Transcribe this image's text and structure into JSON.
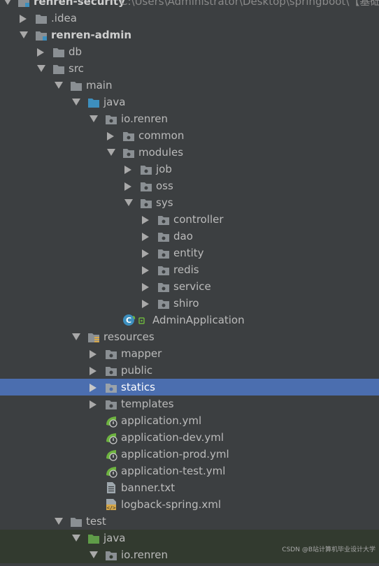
{
  "tree": {
    "root": {
      "label": "renren-security",
      "path": "C:\\Users\\Administrator\\Desktop\\springboot\\【基础..."
    },
    "idea": "idea",
    "admin": "renren-admin",
    "db": "db",
    "src": "src",
    "main": "main",
    "java": "java",
    "io_renren": "io.renren",
    "common": "common",
    "modules": "modules",
    "job": "job",
    "oss": "oss",
    "sys": "sys",
    "controller": "controller",
    "dao": "dao",
    "entity": "entity",
    "redis": "redis",
    "service": "service",
    "shiro": "shiro",
    "admin_app": "AdminApplication",
    "resources": "resources",
    "mapper": "mapper",
    "public": "public",
    "statics": "statics",
    "templates": "templates",
    "app_yml": "application.yml",
    "app_dev_yml": "application-dev.yml",
    "app_prod_yml": "application-prod.yml",
    "app_test_yml": "application-test.yml",
    "banner": "banner.txt",
    "logback": "logback-spring.xml",
    "test": "test",
    "test_java": "java",
    "test_io_renren": "io.renren"
  },
  "watermark": "CSDN @B站计算机毕业设计大学",
  "colors": {
    "background": "#3c3f41",
    "selection": "#4b6eaf",
    "folder": "#8a8f93",
    "source_folder": "#3d8fbe",
    "test_folder": "#5f9c48",
    "spring_green": "#6db33f"
  }
}
